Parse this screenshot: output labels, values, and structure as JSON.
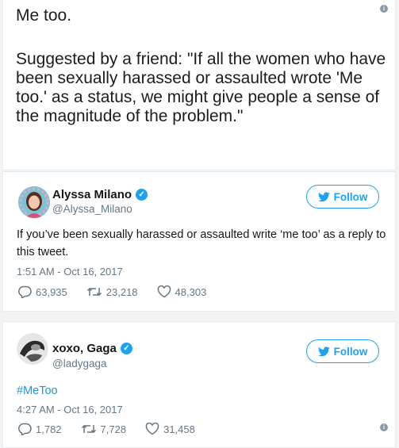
{
  "note": {
    "line1": "Me too.",
    "body": "Suggested by a friend: \"If all the women who have been sexually harassed or assaulted wrote 'Me too.' as a status, we might give people a sense of the magnitude of the problem.\""
  },
  "tweets": [
    {
      "display_name": "Alyssa Milano",
      "handle": "@Alyssa_Milano",
      "follow_label": "Follow",
      "text": "If you’ve been sexually harassed or assaulted write ‘me too’ as a reply to this tweet.",
      "timestamp": "1:51 AM - Oct 16, 2017",
      "replies": "63,935",
      "retweets": "23,218",
      "likes": "48,303"
    },
    {
      "display_name": "xoxo, Gaga",
      "handle": "@ladygaga",
      "follow_label": "Follow",
      "text": "#MeToo",
      "timestamp": "4:27 AM - Oct 16, 2017",
      "replies": "1,782",
      "retweets": "7,728",
      "likes": "31,458"
    }
  ],
  "colors": {
    "accent": "#1da1f2",
    "hashtag": "#1b95e0",
    "muted": "#657786"
  },
  "icons": [
    "info-icon",
    "verified-badge-icon",
    "twitter-bird-icon",
    "reply-icon",
    "retweet-icon",
    "like-icon"
  ]
}
